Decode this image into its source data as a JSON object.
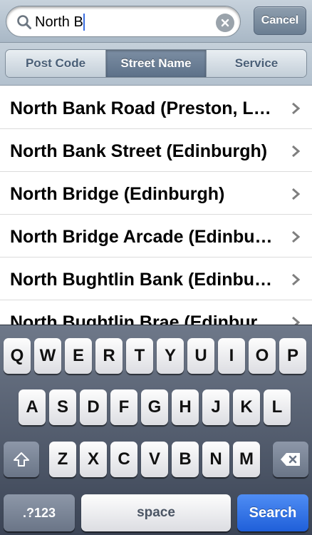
{
  "search": {
    "query": "North B",
    "cancel_label": "Cancel"
  },
  "scope": {
    "segments": [
      "Post Code",
      "Street Name",
      "Service"
    ],
    "selected": "Street Name"
  },
  "results": [
    "North Bank Road (Preston, Lancashire)",
    "North Bank Street (Edinburgh)",
    "North Bridge (Edinburgh)",
    "North Bridge Arcade (Edinburgh)",
    "North Bughtlin Bank (Edinburgh)",
    "North Bughtlin Brae (Edinburgh)"
  ],
  "keyboard": {
    "row1": [
      "Q",
      "W",
      "E",
      "R",
      "T",
      "Y",
      "U",
      "I",
      "O",
      "P"
    ],
    "row2": [
      "A",
      "S",
      "D",
      "F",
      "G",
      "H",
      "J",
      "K",
      "L"
    ],
    "row3": [
      "Z",
      "X",
      "C",
      "V",
      "B",
      "N",
      "M"
    ],
    "numbers_label": ".?123",
    "space_label": "space",
    "return_label": "Search",
    "return_color": "#2a6be0"
  }
}
